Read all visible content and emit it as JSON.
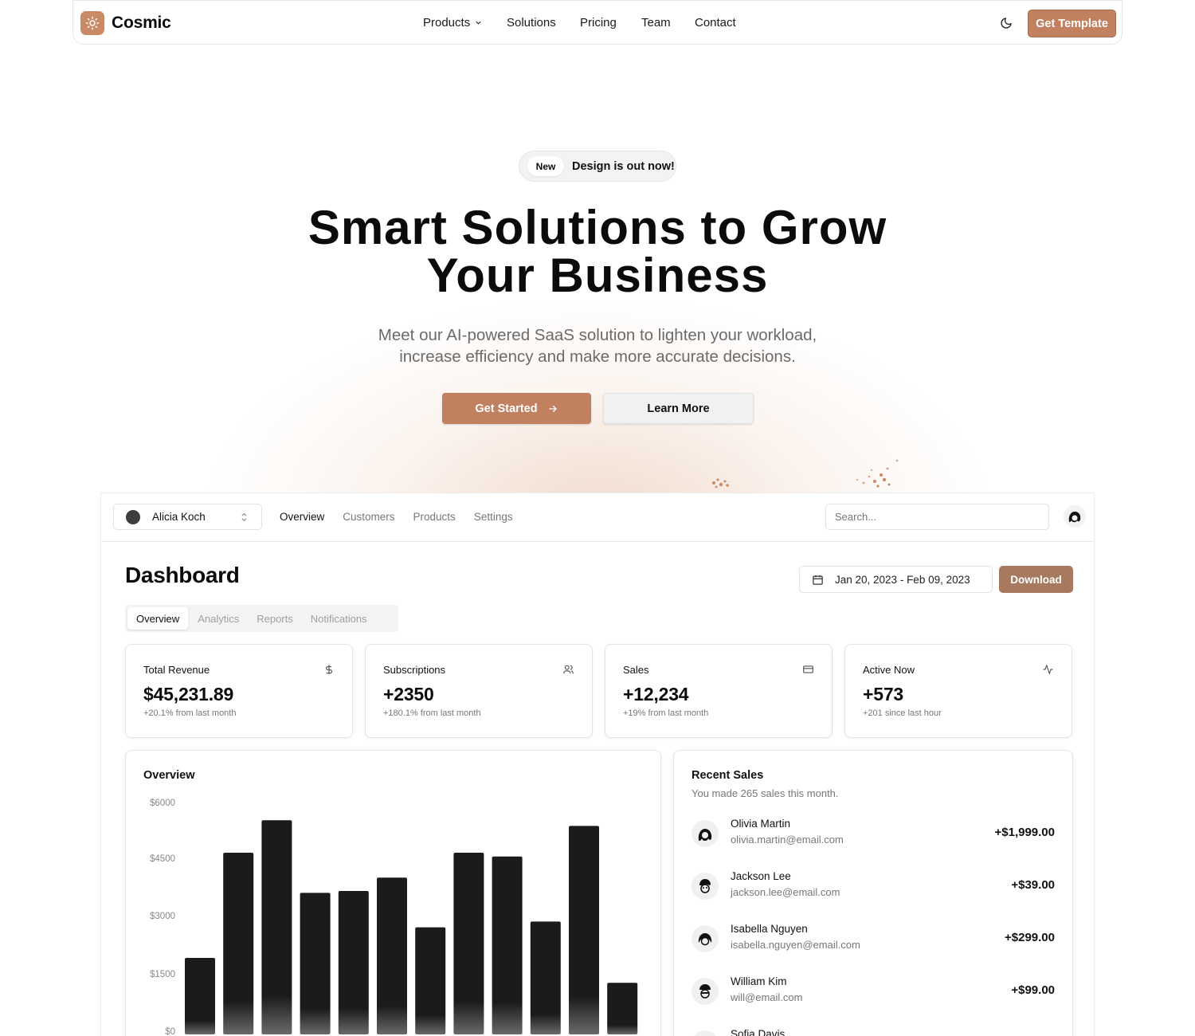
{
  "nav": {
    "brand": "Cosmic",
    "menu": [
      "Products",
      "Solutions",
      "Pricing",
      "Team",
      "Contact"
    ],
    "cta": "Get Template"
  },
  "hero": {
    "badge_tag": "New",
    "badge_text": "Design is out now!",
    "title_line1": "Smart Solutions to Grow",
    "title_line2": "Your Business",
    "subtitle_line1": "Meet our AI-powered SaaS solution to lighten your workload,",
    "subtitle_line2": "increase efficiency and make more accurate decisions.",
    "primary_button": "Get Started",
    "secondary_button": "Learn More"
  },
  "dashboard": {
    "account_name": "Alicia Koch",
    "tabs": [
      "Overview",
      "Customers",
      "Products",
      "Settings"
    ],
    "search_placeholder": "Search...",
    "title": "Dashboard",
    "date_range": "Jan 20, 2023 - Feb 09, 2023",
    "download": "Download",
    "subtabs": [
      "Overview",
      "Analytics",
      "Reports",
      "Notifications"
    ],
    "stats": [
      {
        "label": "Total Revenue",
        "value": "$45,231.89",
        "note": "+20.1% from last month",
        "icon": "dollar-icon"
      },
      {
        "label": "Subscriptions",
        "value": "+2350",
        "note": "+180.1% from last month",
        "icon": "users-icon"
      },
      {
        "label": "Sales",
        "value": "+12,234",
        "note": "+19% from last month",
        "icon": "credit-card-icon"
      },
      {
        "label": "Active Now",
        "value": "+573",
        "note": "+201 since last hour",
        "icon": "activity-icon"
      }
    ],
    "overview_title": "Overview",
    "recent_sales": {
      "title": "Recent Sales",
      "subtitle": "You made 265 sales this month.",
      "items": [
        {
          "name": "Olivia Martin",
          "email": "olivia.martin@email.com",
          "amount": "+$1,999.00"
        },
        {
          "name": "Jackson Lee",
          "email": "jackson.lee@email.com",
          "amount": "+$39.00"
        },
        {
          "name": "Isabella Nguyen",
          "email": "isabella.nguyen@email.com",
          "amount": "+$299.00"
        },
        {
          "name": "William Kim",
          "email": "will@email.com",
          "amount": "+$99.00"
        },
        {
          "name": "Sofia Davis",
          "email": "",
          "amount": ""
        }
      ]
    }
  },
  "colors": {
    "accent": "#c1805f",
    "download": "#a7795f",
    "bar": "#1b1b1c"
  },
  "chart_data": {
    "type": "bar",
    "title": "Overview",
    "y_ticks": [
      "$6000",
      "$4500",
      "$3000",
      "$1500",
      "$0"
    ],
    "ylim": [
      0,
      6000
    ],
    "values": [
      2000,
      4750,
      5600,
      3700,
      3750,
      4100,
      2800,
      4750,
      4650,
      2950,
      5450,
      1350
    ]
  }
}
